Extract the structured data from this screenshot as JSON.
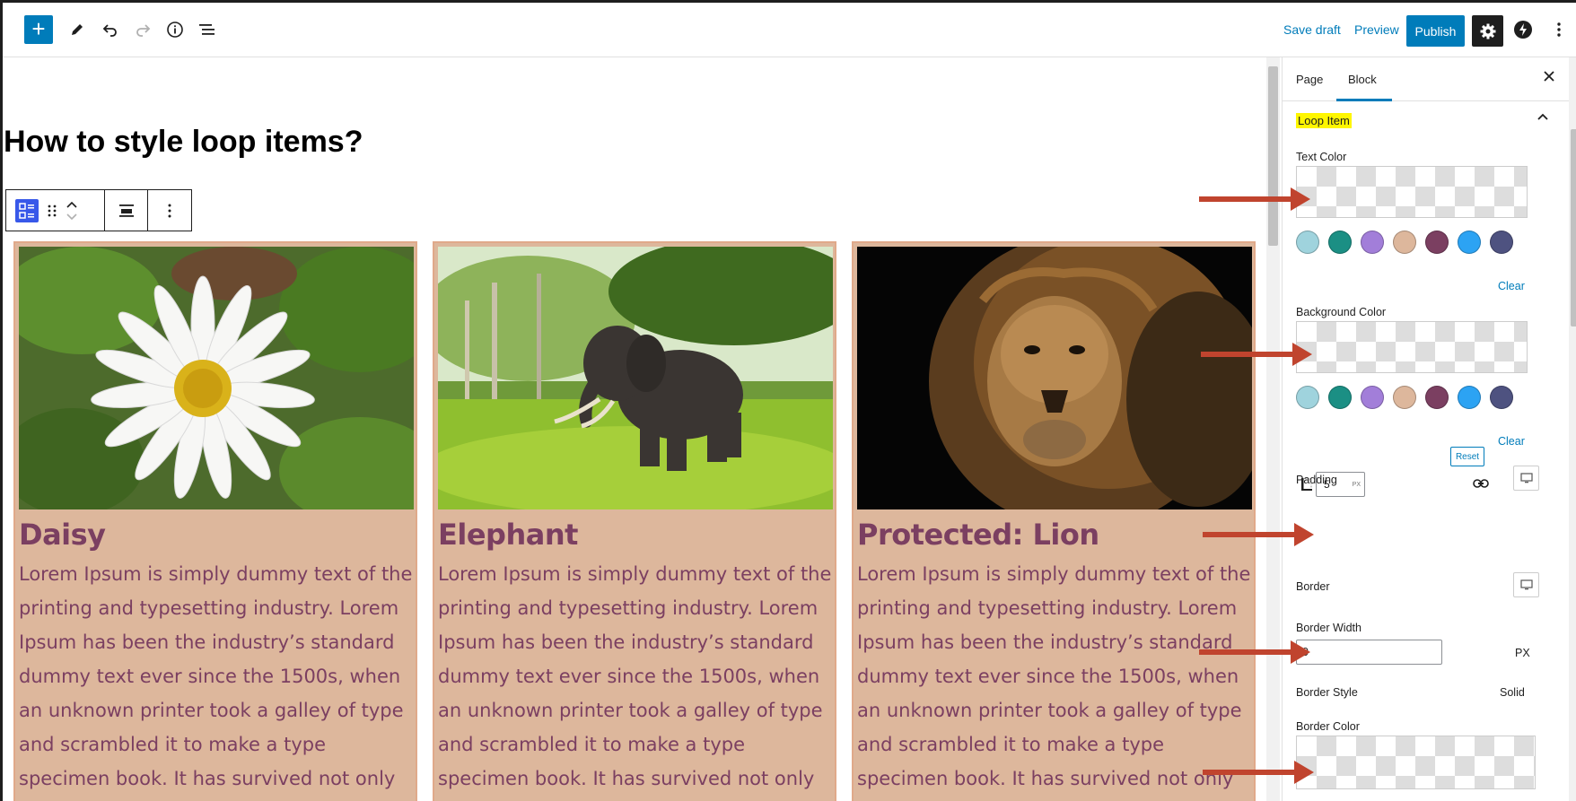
{
  "toolbar": {
    "save_draft": "Save draft",
    "preview": "Preview",
    "publish": "Publish"
  },
  "editor": {
    "page_title": "How to style loop items?",
    "items": [
      {
        "title": "Daisy",
        "image": "daisy-photo",
        "body": "Lorem Ipsum is simply dummy text of the printing and typesetting industry. Lorem Ipsum has been the industry’s standard dummy text ever since the 1500s, when an unknown printer took a galley of type and scrambled it to make a type specimen book. It has survived not only"
      },
      {
        "title": "Elephant",
        "image": "elephant-photo",
        "body": "Lorem Ipsum is simply dummy text of the printing and typesetting industry. Lorem Ipsum has been the industry’s standard dummy text ever since the 1500s, when an unknown printer took a galley of type and scrambled it to make a type specimen book. It has survived not only"
      },
      {
        "title": "Protected: Lion",
        "image": "lion-photo",
        "body": "Lorem Ipsum is simply dummy text of the printing and typesetting industry. Lorem Ipsum has been the industry’s standard dummy text ever since the 1500s, when an unknown printer took a galley of type and scrambled it to make a type specimen book. It has survived not only"
      }
    ],
    "item_background": "#ddb79c",
    "item_text_color": "#7b3f61"
  },
  "sidebar": {
    "tabs": [
      "Page",
      "Block"
    ],
    "active_tab": "Block",
    "panel_title": "Loop Item",
    "text_color_label": "Text Color",
    "background_color_label": "Background Color",
    "palette": [
      "#9fd3dd",
      "#1b8f84",
      "#a27ed9",
      "#ddb79c",
      "#7b3f61",
      "#2ca3f3",
      "#4e5280"
    ],
    "clear": "Clear",
    "padding_label": "Padding",
    "reset": "Reset",
    "padding_value": "5",
    "padding_unit": "PX",
    "border_label": "Border",
    "border_width_label": "Border Width",
    "border_width_value": "0",
    "border_width_unit": "PX",
    "border_style_label": "Border Style",
    "border_style_value": "Solid",
    "border_color_label": "Border Color"
  },
  "accent_color": "#007cba",
  "annotation_arrow_color": "#c0442e"
}
